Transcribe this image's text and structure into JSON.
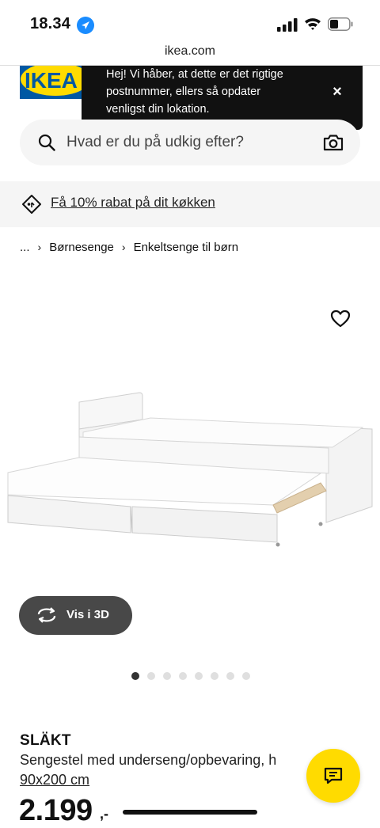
{
  "status_bar": {
    "time": "18.34"
  },
  "browser": {
    "url": "ikea.com"
  },
  "logo": {
    "text": "IKEA"
  },
  "location_toast": {
    "message": "Hej! Vi håber, at dette er det rigtige postnummer, ellers så opdater venligst din lokation.",
    "close": "×"
  },
  "search": {
    "placeholder": "Hvad er du på udkig efter?"
  },
  "promo": {
    "text": "Få 10% rabat på dit køkken"
  },
  "breadcrumb": {
    "ellipsis": "...",
    "sep": "›",
    "items": [
      "Børnesenge",
      "Enkeltsenge til børn"
    ]
  },
  "gallery": {
    "view_3d_label": "Vis i 3D",
    "dot_count": 8,
    "active_dot": 0
  },
  "product": {
    "name": "SLÄKT",
    "description": "Sengestel med underseng/opbevaring, h",
    "size": "90x200 cm",
    "price": "2.199",
    "price_suffix": ",-"
  },
  "colors": {
    "ikea_blue": "#0058a3",
    "ikea_yellow": "#ffdb00",
    "toast_bg": "#111111"
  },
  "icons": [
    "location-arrow-icon",
    "signal-icon",
    "wifi-icon",
    "battery-icon",
    "search-icon",
    "camera-icon",
    "tag-icon",
    "heart-icon",
    "rotate-3d-icon",
    "chat-icon",
    "close-icon"
  ]
}
